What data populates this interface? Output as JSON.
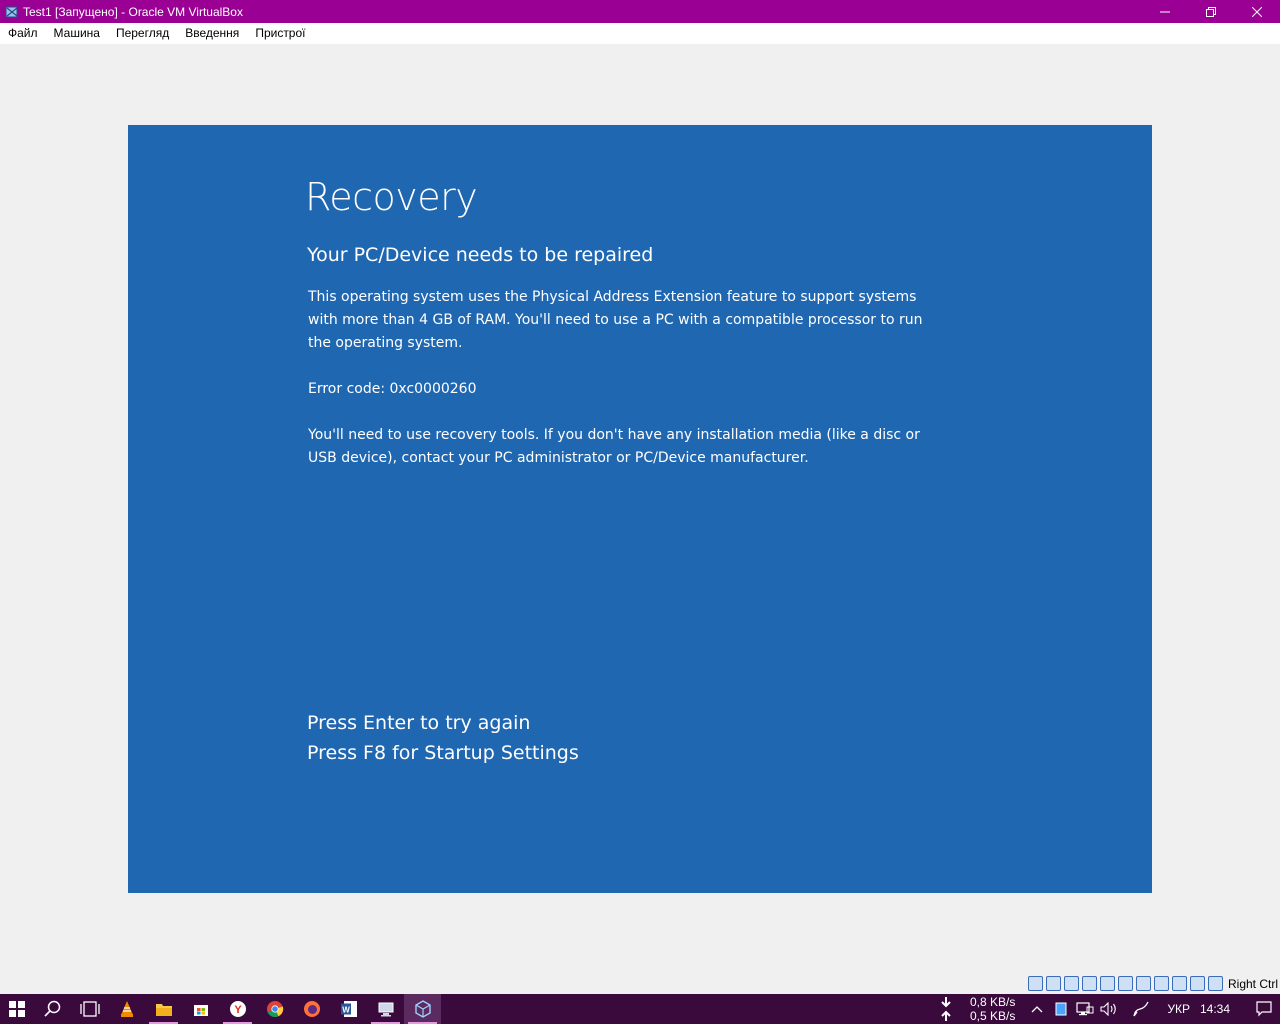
{
  "window": {
    "title": "Test1 [Запущено] - Oracle VM VirtualBox"
  },
  "menu": {
    "items": [
      "Файл",
      "Машина",
      "Перегляд",
      "Введення",
      "Пристрої"
    ]
  },
  "recovery": {
    "title": "Recovery",
    "subtitle": "Your PC/Device needs to be repaired",
    "body1": "This operating system uses the Physical Address Extension feature to support systems with more than 4 GB of RAM.  You'll need to use a PC with a compatible processor to run the operating system.",
    "error": "Error code: 0xc0000260",
    "body2": "You'll need to use recovery tools. If you don't have any installation media (like a disc or USB device), contact your PC administrator or PC/Device manufacturer.",
    "option1": "Press Enter to try again",
    "option2": "Press F8 for Startup Settings"
  },
  "status": {
    "host_key": "Right Ctrl"
  },
  "tray": {
    "down_speed": "0,8 KB/s",
    "up_speed": "0,5 KB/s",
    "language": "УКР",
    "time": "14:34"
  },
  "colors": {
    "titlebar": "#9b0095",
    "vm_background": "#2067b2",
    "taskbar": "#3a0a3d"
  }
}
